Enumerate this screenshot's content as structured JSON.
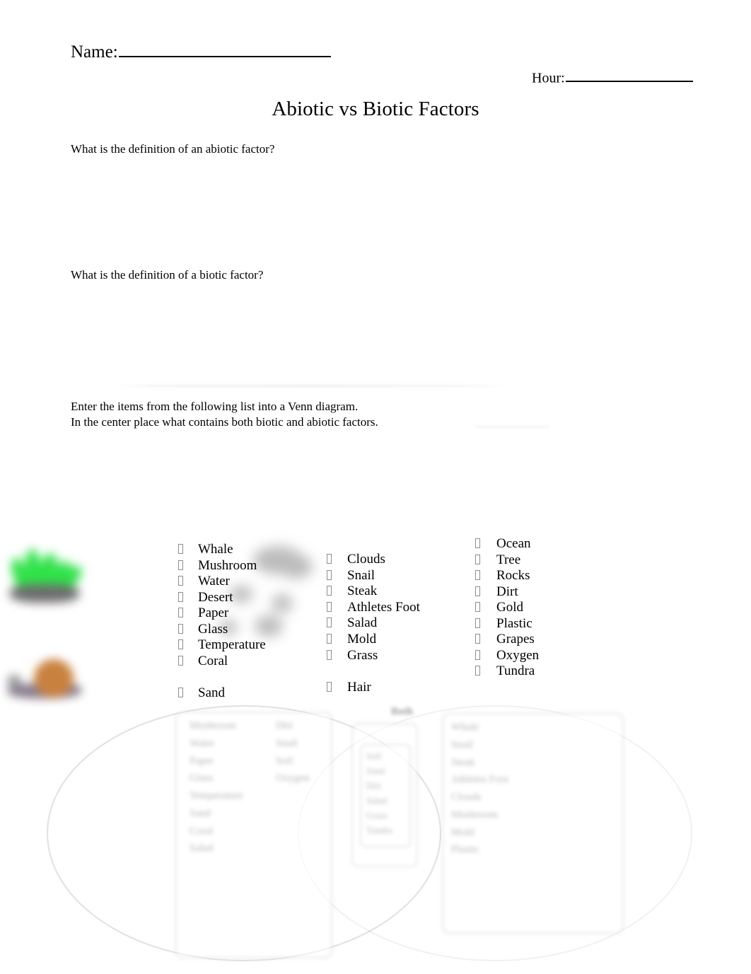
{
  "header": {
    "name_label": "Name:",
    "hour_label": "Hour:",
    "title": "Abiotic vs Biotic Factors"
  },
  "prompts": {
    "abiotic_question": "What is the definition of an abiotic factor?",
    "biotic_question": "What is the definition of a biotic factor?",
    "venn_instructions": "Enter the items from the following list into a Venn diagram.\nIn the center place what contains both biotic and abiotic factors."
  },
  "word_list": {
    "bullet_glyph": "□",
    "columns": [
      {
        "name": "column-1",
        "items": [
          "Whale",
          "Mushroom",
          "Water",
          "Desert",
          "Paper",
          "Glass",
          "Temperature",
          "Coral",
          "",
          "Sand"
        ]
      },
      {
        "name": "column-2",
        "items": [
          "Clouds",
          "Snail",
          "Steak",
          "Athletes Foot",
          "Salad",
          "Mold",
          "Grass",
          "",
          "Hair"
        ]
      },
      {
        "name": "column-3",
        "items": [
          "Ocean",
          "Tree",
          "Rocks",
          "Dirt",
          "Gold",
          "Plastic",
          "Grapes",
          "Oxygen",
          "Tundra"
        ]
      }
    ]
  },
  "venn": {
    "left_circle_label": "",
    "right_circle_label": "",
    "center_label": ""
  },
  "ghost_overlay": {
    "note": "blurred answer-key overlay, text largely illegible",
    "center_heading": "Both",
    "left_column_a": [
      "Mushroom",
      "Water",
      "Paper",
      "Glass",
      "Temperature",
      "Sand",
      "Coral",
      "Salad"
    ],
    "left_column_b": [
      "Dirt",
      "Snail",
      "Soil",
      "Oxygen"
    ],
    "center_column": [
      "Soil",
      "Sand",
      "Dirt",
      "Salad",
      "Grass",
      "Tundra"
    ],
    "right_column": [
      "Whale",
      "Snail",
      "Steak",
      "Athletes Foot",
      "Clouds",
      "Mushroom",
      "Mold",
      "Plastic"
    ],
    "footer": ""
  },
  "clipart": {
    "grass_color": "#2fe249",
    "soil_color": "#6d6d6d",
    "snail_shell_color": "#c9813f",
    "snail_body_color": "#8a7f8f"
  },
  "colors": {
    "text": "#000000",
    "rule": "#000000",
    "ghost": "rgba(0,0,0,0.30)"
  }
}
